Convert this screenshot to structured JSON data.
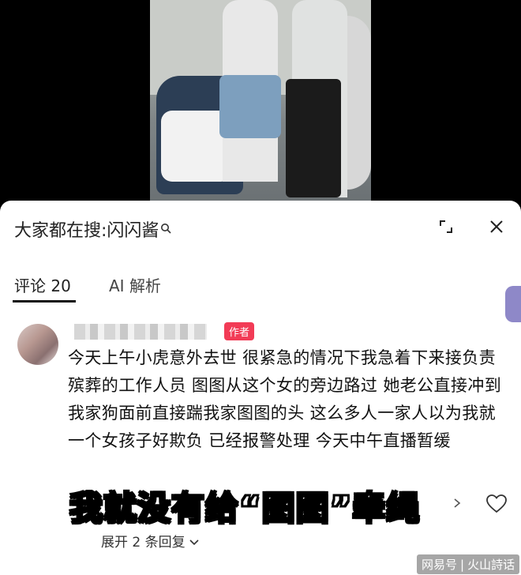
{
  "search": {
    "hint_label": "大家都在搜:",
    "keyword": "闪闪酱",
    "icon": "search-icon"
  },
  "header": {
    "expand_icon": "expand-icon",
    "close_icon": "close-icon"
  },
  "tabs": [
    {
      "label": "评论 20",
      "active": true
    },
    {
      "label": "AI 解析",
      "active": false
    }
  ],
  "comment": {
    "badge": "作者",
    "text": "今天上午小虎意外去世 很紧急的情况下我急着下来接负责殡葬的工作人员 图图从这个女的旁边路过 她老公直接冲到我家狗面前直接踹我家图图的头 这么多人一家人以为我就一个女孩子好欺负 已经报警处理 今天中午直播暂缓",
    "expand_replies": "展开 2 条回复"
  },
  "overlay_caption": "我就没有给“图图”牵绳",
  "watermark": {
    "site": "网易号",
    "account": "火山詩话"
  },
  "colors": {
    "accent": "#f23b56",
    "panel_bg": "#ffffff"
  }
}
